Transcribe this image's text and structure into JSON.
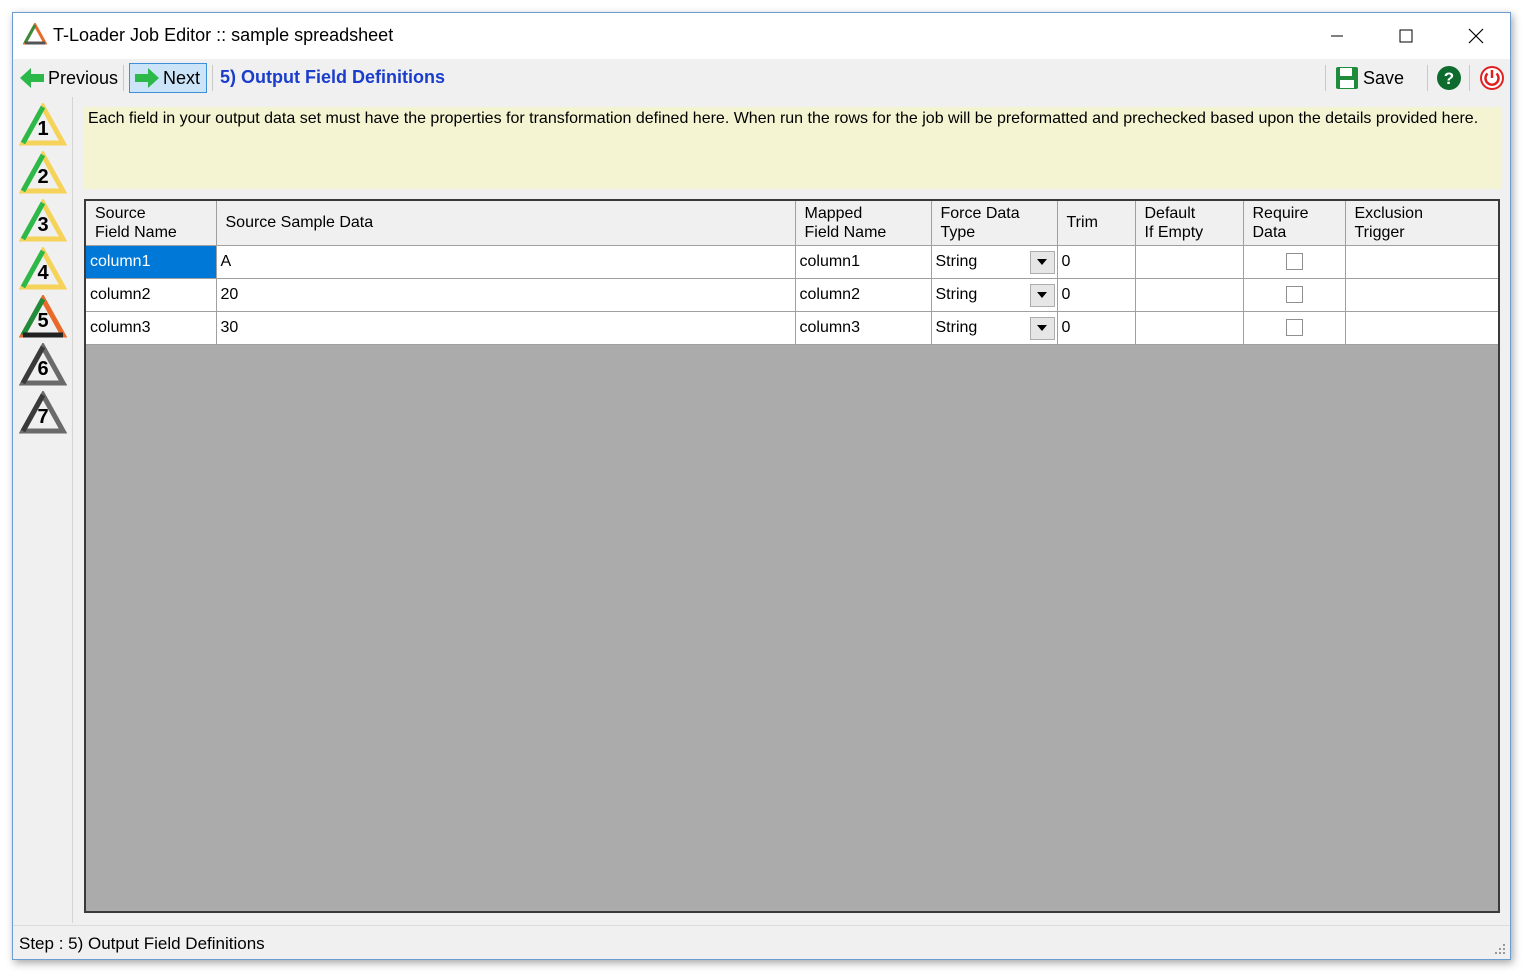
{
  "window": {
    "title": "T-Loader Job Editor :: sample spreadsheet"
  },
  "toolbar": {
    "previous_label": "Previous",
    "next_label": "Next",
    "step_title": "5) Output Field Definitions",
    "save_label": "Save",
    "help_icon": "help-icon",
    "power_icon": "power-icon"
  },
  "sidebar": {
    "steps": [
      "1",
      "2",
      "3",
      "4",
      "5",
      "6",
      "7"
    ],
    "active_step": "5"
  },
  "info": {
    "text": "Each field in your output data set must have the properties for transformation defined here. When run the rows for the job will be preformatted and prechecked based upon the details provided here."
  },
  "grid": {
    "headers": [
      [
        "Source",
        "Field Name"
      ],
      [
        "Source Sample Data",
        ""
      ],
      [
        "Mapped",
        "Field Name"
      ],
      [
        "Force Data",
        "Type"
      ],
      [
        "Trim",
        ""
      ],
      [
        "Default",
        "If Empty"
      ],
      [
        "Require",
        "Data"
      ],
      [
        "Exclusion",
        "Trigger"
      ]
    ],
    "rows": [
      {
        "source": "column1",
        "sample": "A",
        "mapped": "column1",
        "type": "String",
        "trim": "0",
        "default": "",
        "require": false,
        "exclusion": ""
      },
      {
        "source": "column2",
        "sample": "20",
        "mapped": "column2",
        "type": "String",
        "trim": "0",
        "default": "",
        "require": false,
        "exclusion": ""
      },
      {
        "source": "column3",
        "sample": "30",
        "mapped": "column3",
        "type": "String",
        "trim": "0",
        "default": "",
        "require": false,
        "exclusion": ""
      }
    ]
  },
  "status": {
    "text": "Step : 5) Output Field Definitions"
  },
  "colors": {
    "step_title": "#1a3dcc",
    "info_bg": "#f4f4d2",
    "grid_bg": "#ababab",
    "selection": "#0078d7"
  }
}
